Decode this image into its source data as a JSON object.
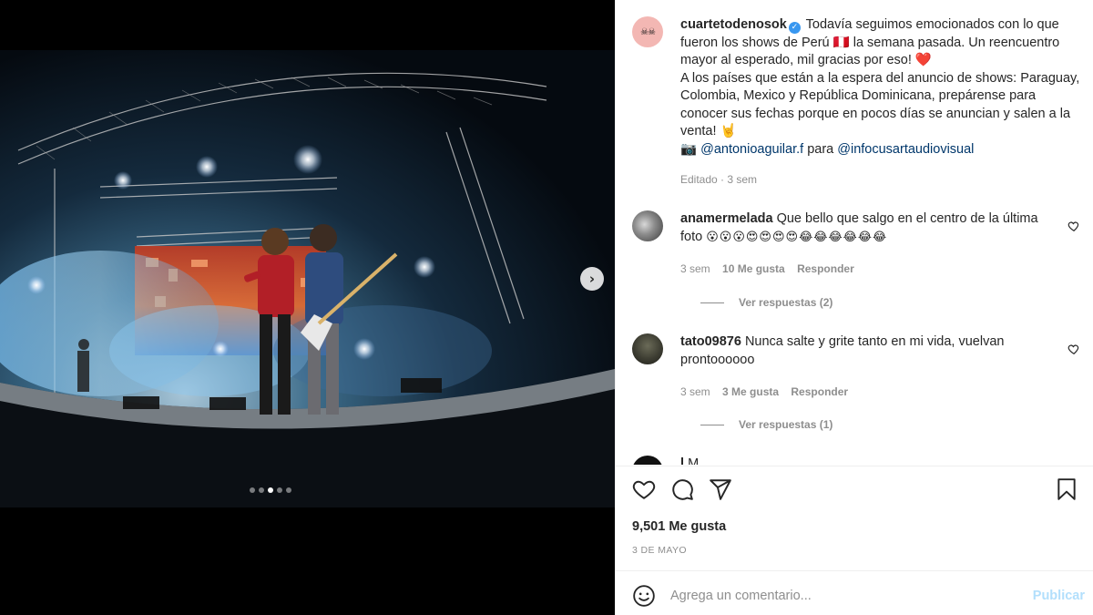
{
  "post": {
    "author": "cuartetodenosok",
    "avatar_text": "☠☠",
    "caption_lines": [
      "Todavía seguimos emocionados con lo que fueron los shows de Perú 🇵🇪 la semana pasada. Un reencuentro mayor al esperado, mil gracias por eso!",
      "A los países que están a la espera del anuncio de shows: Paraguay, Colombia, Mexico y República Dominicana, prepárense para conocer sus fechas porque en pocos días se anuncian y salen a la venta! 🤘"
    ],
    "heart_emoji": "❤️",
    "camera_emoji": "📷",
    "credit_user": "@antonioaguilar.f",
    "credit_para": "para",
    "credit_studio": "@infocusartaudiovisual",
    "edited_meta": "Editado · 3 sem"
  },
  "comments": [
    {
      "user": "anamermelada",
      "text": "Que bello que salgo en el centro de la última foto",
      "emojis": "😮😮😮😍😍😍😍😂😂😂😂😂😂",
      "time": "3 sem",
      "likes": "10 Me gusta",
      "reply": "Responder",
      "view_replies": "Ver respuestas (2)"
    },
    {
      "user": "tato09876",
      "text": "Nunca salte y grite tanto en mi vida, vuelvan prontoooooo",
      "time": "3 sem",
      "likes": "3 Me gusta",
      "reply": "Responder",
      "view_replies": "Ver respuestas (1)"
    },
    {
      "user": "l",
      "text": "M"
    }
  ],
  "stats": {
    "likes": "9,501 Me gusta",
    "date": "3 DE MAYO"
  },
  "composer": {
    "placeholder": "Agrega un comentario...",
    "publish": "Publicar"
  },
  "carousel": {
    "total": 5,
    "active": 3,
    "next_glyph": "›"
  },
  "icons": {
    "like": "heart-outline-icon",
    "comment": "comment-bubble-icon",
    "share": "paper-plane-icon",
    "save": "bookmark-icon",
    "emoji": "smiley-icon",
    "verified": "verified-badge-icon"
  },
  "colors": {
    "link": "#00376b",
    "muted": "#8e8e8e",
    "publish_disabled": "#b2dffc",
    "verified": "#3897f0"
  }
}
